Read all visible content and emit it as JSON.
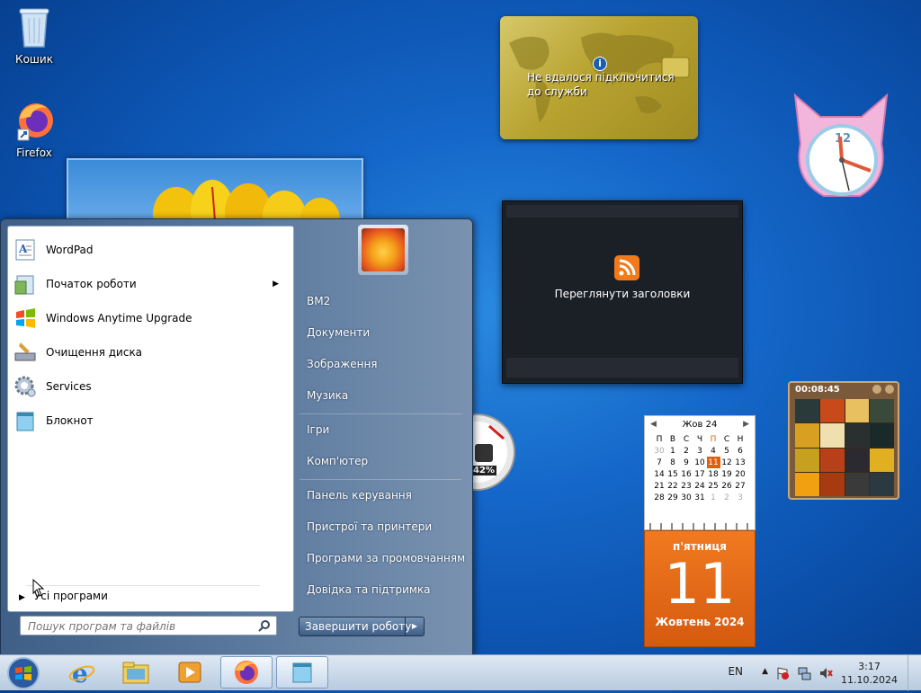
{
  "desktop": {
    "icons": [
      {
        "label": "Кошик",
        "icon": "recycle-bin-icon"
      },
      {
        "label": "Firefox",
        "icon": "firefox-icon"
      }
    ]
  },
  "gadgets": {
    "weather": {
      "message": "Не вдалося підключитися до служби",
      "info_icon": "info-icon"
    },
    "feeds": {
      "label": "Переглянути заголовки",
      "icon": "rss-icon"
    },
    "cpu_meter": {
      "value": "42%"
    },
    "puzzle": {
      "timer": "00:08:45"
    },
    "calendar": {
      "month_header": "Жов 24",
      "weekdays": [
        "П",
        "В",
        "С",
        "Ч",
        "П",
        "С",
        "Н"
      ],
      "weeks": [
        [
          "30",
          "1",
          "2",
          "3",
          "4",
          "5",
          "6"
        ],
        [
          "7",
          "8",
          "9",
          "10",
          "11",
          "12",
          "13"
        ],
        [
          "14",
          "15",
          "16",
          "17",
          "18",
          "19",
          "20"
        ],
        [
          "21",
          "22",
          "23",
          "24",
          "25",
          "26",
          "27"
        ],
        [
          "28",
          "29",
          "30",
          "31",
          "1",
          "2",
          "3"
        ]
      ],
      "today": "11",
      "weekday_name": "п'ятниця",
      "day": "11",
      "month_year": "Жовтень 2024"
    }
  },
  "start_menu": {
    "programs": [
      {
        "label": "WordPad",
        "icon": "wordpad-icon",
        "submenu": false
      },
      {
        "label": "Початок роботи",
        "icon": "getting-started-icon",
        "submenu": true
      },
      {
        "label": "Windows Anytime Upgrade",
        "icon": "windows-flag-icon",
        "submenu": false
      },
      {
        "label": "Очищення диска",
        "icon": "disk-cleanup-icon",
        "submenu": false
      },
      {
        "label": "Services",
        "icon": "services-gear-icon",
        "submenu": false
      },
      {
        "label": "Блокнот",
        "icon": "notepad-icon",
        "submenu": false
      }
    ],
    "all_programs": "Усі програми",
    "search_placeholder": "Пошук програм та файлів",
    "right_items": [
      "ВМ2",
      "Документи",
      "Зображення",
      "Музика",
      "Ігри",
      "Комп'ютер",
      "Панель керування",
      "Пристрої та принтери",
      "Програми за промовчанням",
      "Довідка та підтримка"
    ],
    "shutdown_label": "Завершити роботу"
  },
  "taskbar": {
    "pinned": [
      "internet-explorer-icon",
      "explorer-folder-icon",
      "media-player-icon",
      "firefox-icon",
      "notepad-icon"
    ],
    "language": "EN",
    "time": "3:17",
    "date": "11.10.2024"
  },
  "colors": {
    "accent": "#1466c8",
    "calendar_orange": "#e06010",
    "rss_orange": "#f27a1a"
  }
}
